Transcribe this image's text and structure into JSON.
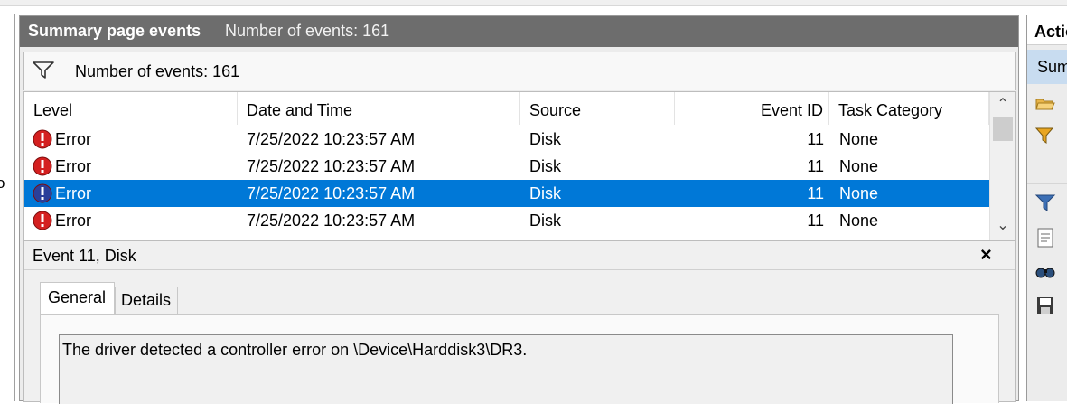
{
  "left_pane": {
    "text": "o"
  },
  "summary": {
    "title": "Summary page events",
    "count_label": "Number of events: 161"
  },
  "filter": {
    "label": "Number of events: 161",
    "icon": "filter-icon"
  },
  "columns": [
    "Level",
    "Date and Time",
    "Source",
    "Event ID",
    "Task Category"
  ],
  "events": [
    {
      "level": "Error",
      "datetime": "7/25/2022 10:23:57 AM",
      "source": "Disk",
      "event_id": "11",
      "task_category": "None"
    },
    {
      "level": "Error",
      "datetime": "7/25/2022 10:23:57 AM",
      "source": "Disk",
      "event_id": "11",
      "task_category": "None"
    },
    {
      "level": "Error",
      "datetime": "7/25/2022 10:23:57 AM",
      "source": "Disk",
      "event_id": "11",
      "task_category": "None"
    },
    {
      "level": "Error",
      "datetime": "7/25/2022 10:23:57 AM",
      "source": "Disk",
      "event_id": "11",
      "task_category": "None"
    }
  ],
  "selected_row": 2,
  "detail": {
    "title": "Event 11, Disk",
    "close": "×",
    "tabs": [
      "General",
      "Details"
    ],
    "description": "The driver detected a controller error on \\Device\\Harddisk3\\DR3."
  },
  "actions": {
    "header": "Actions",
    "subheader": "Summary page events",
    "icons": [
      "open-folder-icon",
      "filter-icon",
      "filter-icon",
      "properties-icon",
      "find-icon",
      "save-icon"
    ]
  },
  "colors": {
    "selection": "#0078d7",
    "summary_bar": "#6d6d6d",
    "error": "#d42020"
  }
}
